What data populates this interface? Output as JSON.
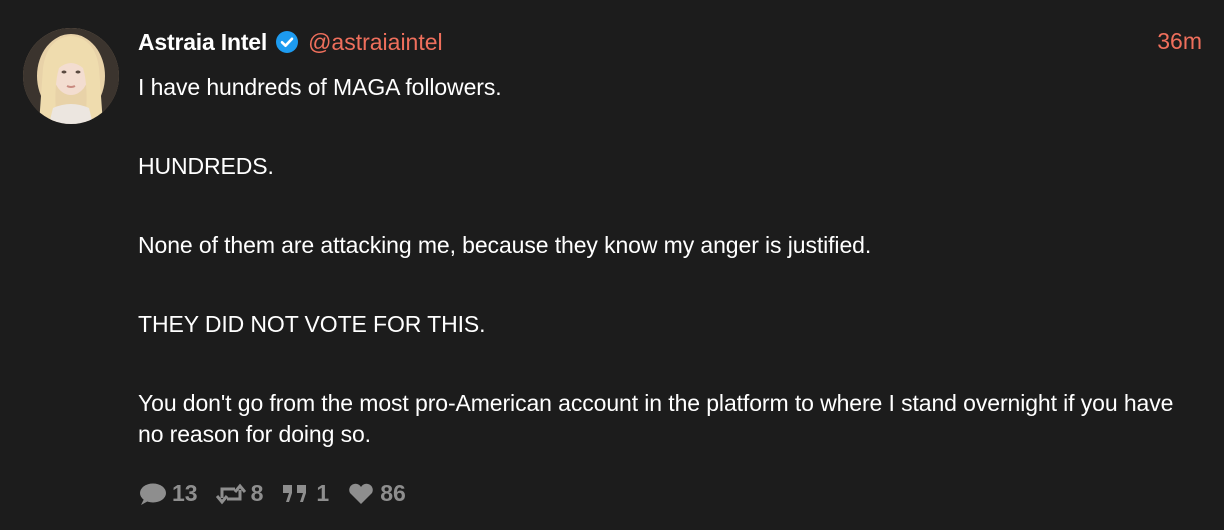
{
  "post": {
    "author": {
      "display_name": "Astraia Intel",
      "handle": "@astraiaintel",
      "verified": true
    },
    "timestamp": "36m",
    "paragraphs": [
      "I have hundreds of MAGA followers.",
      "HUNDREDS.",
      "None of them are attacking me, because they know my anger is justified.",
      "THEY DID NOT VOTE FOR THIS.",
      "You don't go from the most pro-American account in the platform to where I stand overnight if you have no reason for doing so."
    ],
    "stats": {
      "replies": "13",
      "reposts": "8",
      "quotes": "1",
      "likes": "86"
    }
  },
  "icons": {
    "reply": "speech-bubble-icon",
    "repost": "repost-arrows-icon",
    "quote": "quote-marks-icon",
    "like": "heart-icon",
    "verified": "verified-check-icon"
  },
  "colors": {
    "background": "#1c1c1c",
    "text": "#ffffff",
    "accent": "#ef6f5c",
    "muted": "#8e8e8e",
    "verified_badge": "#1d9bf0"
  }
}
